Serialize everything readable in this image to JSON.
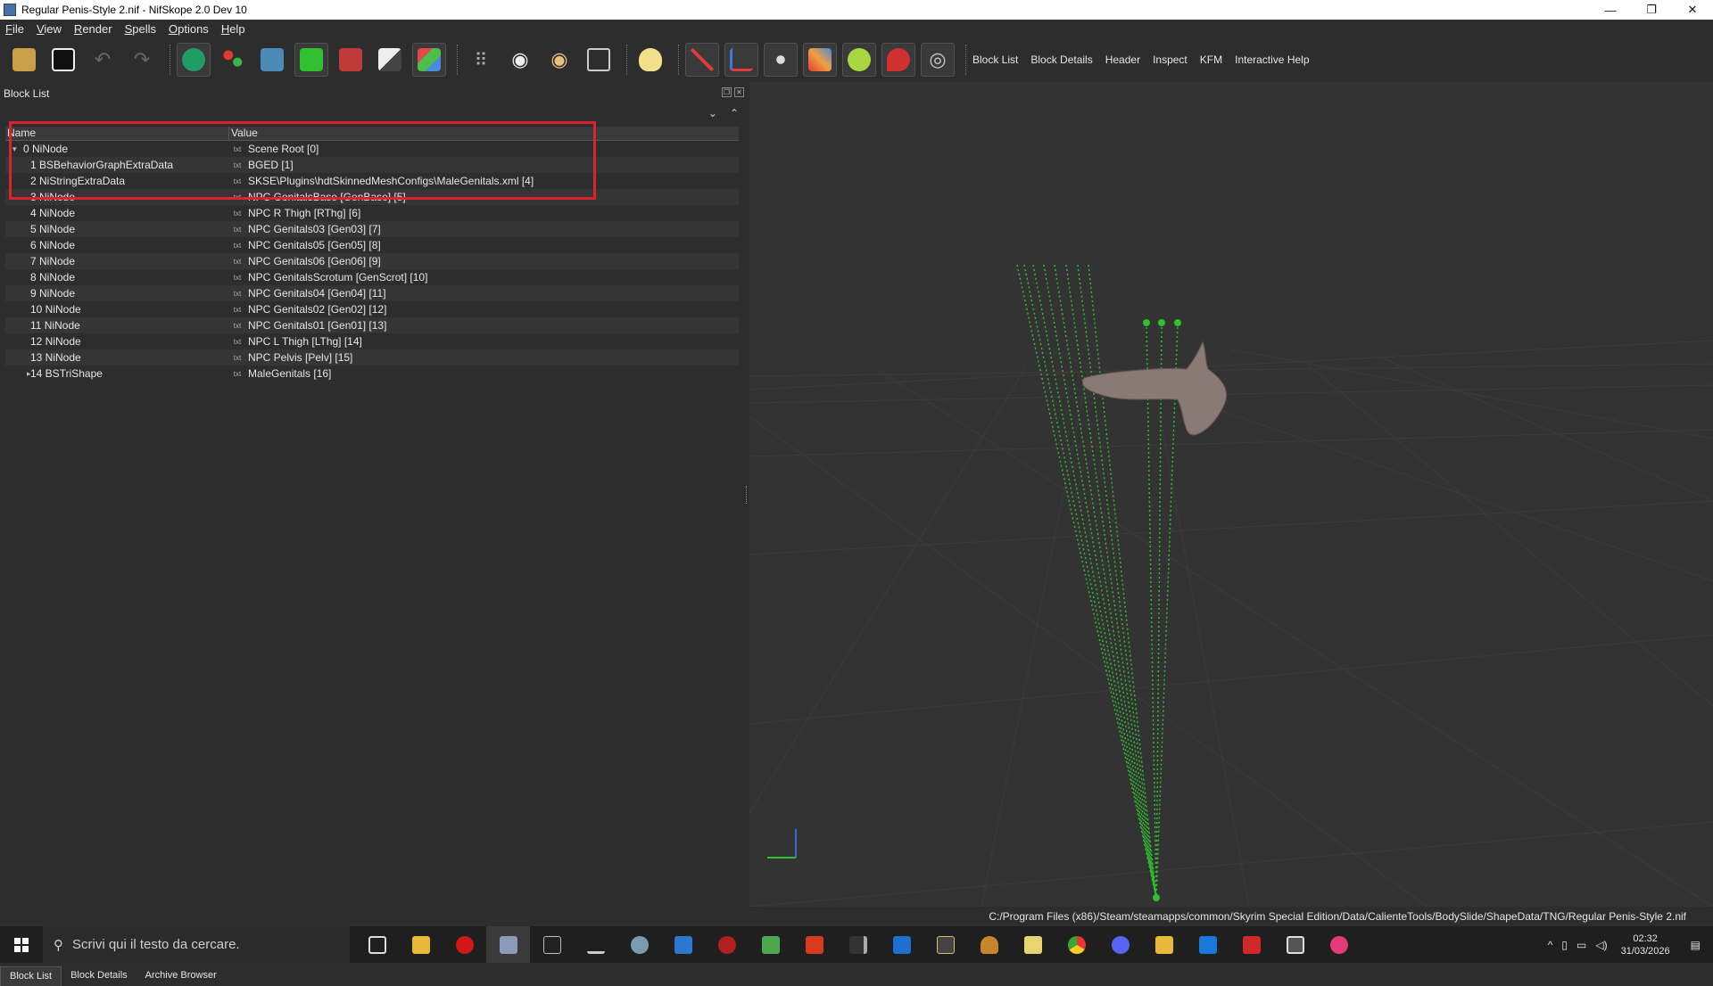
{
  "window": {
    "title": "Regular Penis-Style 2.nif - NifSkope 2.0 Dev 10",
    "controls": [
      "—",
      "❐",
      "✕"
    ]
  },
  "menu": [
    "File",
    "View",
    "Render",
    "Spells",
    "Options",
    "Help"
  ],
  "toolbar": {
    "text_buttons": [
      "Block List",
      "Block Details",
      "Header",
      "Inspect",
      "KFM",
      "Interactive Help"
    ]
  },
  "block_list": {
    "title": "Block List",
    "columns": {
      "name": "Name",
      "value": "Value"
    },
    "rows": [
      {
        "name": "0 NiNode",
        "value": "Scene Root [0]"
      },
      {
        "name": "1 BSBehaviorGraphExtraData",
        "value": "BGED [1]"
      },
      {
        "name": "2 NiStringExtraData",
        "value": "SKSE\\Plugins\\hdtSkinnedMeshConfigs\\MaleGenitals.xml [4]"
      },
      {
        "name": "3 NiNode",
        "value": "NPC GenitalsBase [GenBase] [5]"
      },
      {
        "name": "4 NiNode",
        "value": "NPC R Thigh [RThg] [6]"
      },
      {
        "name": "5 NiNode",
        "value": "NPC Genitals03 [Gen03] [7]"
      },
      {
        "name": "6 NiNode",
        "value": "NPC Genitals05 [Gen05] [8]"
      },
      {
        "name": "7 NiNode",
        "value": "NPC Genitals06 [Gen06] [9]"
      },
      {
        "name": "8 NiNode",
        "value": "NPC GenitalsScrotum [GenScrot] [10]"
      },
      {
        "name": "9 NiNode",
        "value": "NPC Genitals04 [Gen04] [11]"
      },
      {
        "name": "10 NiNode",
        "value": "NPC Genitals02 [Gen02] [12]"
      },
      {
        "name": "11 NiNode",
        "value": "NPC Genitals01 [Gen01] [13]"
      },
      {
        "name": "12 NiNode",
        "value": "NPC L Thigh [LThg] [14]"
      },
      {
        "name": "13 NiNode",
        "value": "NPC Pelvis [Pelv] [15]"
      },
      {
        "name": "14 BSTriShape",
        "value": "MaleGenitals [16]"
      }
    ],
    "value_icon": "txt"
  },
  "bottom_tabs": [
    "Block List",
    "Block Details",
    "Archive Browser"
  ],
  "status": {
    "path": "C:/Program Files (x86)/Steam/steamapps/common/Skyrim Special Edition/Data/CalienteTools/BodySlide/ShapeData/TNG/Regular Penis-Style 2.nif"
  },
  "taskbar": {
    "search_placeholder": "Scrivi qui il testo da cercare.",
    "time": "02:32",
    "date": "31/03/2026"
  },
  "colors": {
    "highlight": "#d9232d",
    "bone_lines": "#2fbf2f",
    "mesh": "#8a7a75"
  }
}
